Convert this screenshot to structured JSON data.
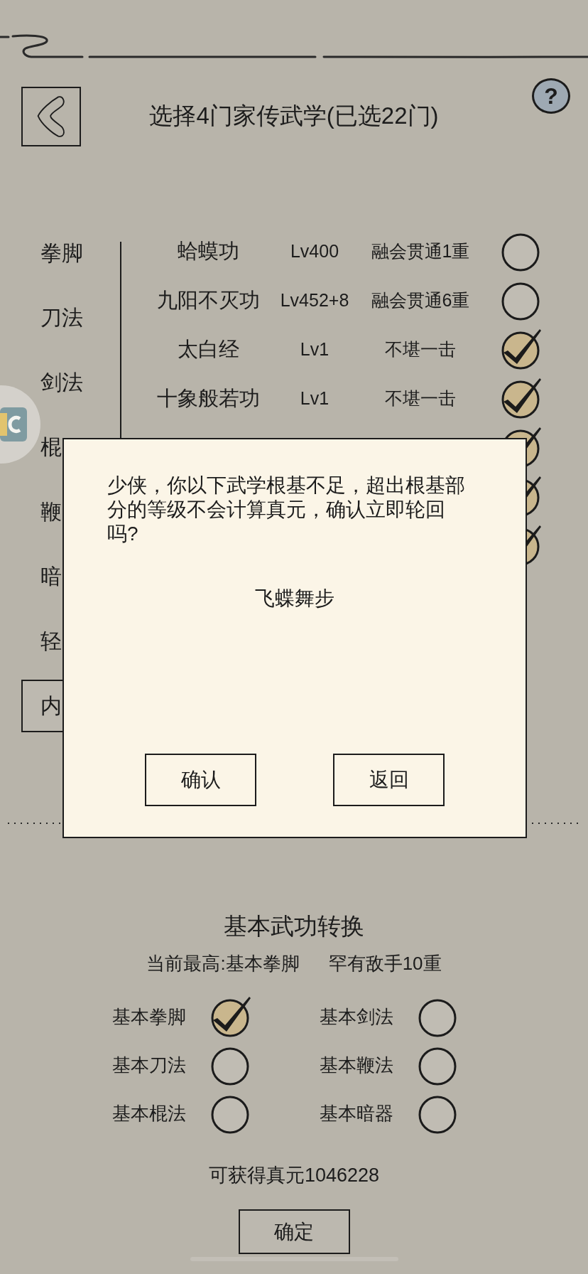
{
  "header": {
    "title": "选择4门家传武学(已选22门)",
    "help": "?"
  },
  "categories": [
    {
      "label": "拳脚",
      "selected": false
    },
    {
      "label": "刀法",
      "selected": false
    },
    {
      "label": "剑法",
      "selected": false
    },
    {
      "label": "棍",
      "selected": false
    },
    {
      "label": "鞭",
      "selected": false
    },
    {
      "label": "暗",
      "selected": false
    },
    {
      "label": "轻",
      "selected": false
    },
    {
      "label": "内",
      "selected": true
    }
  ],
  "skills": [
    {
      "name": "蛤蟆功",
      "level": "Lv400",
      "rank": "融会贯通1重",
      "checked": false
    },
    {
      "name": "九阳不灭功",
      "level": "Lv452+8",
      "rank": "融会贯通6重",
      "checked": false
    },
    {
      "name": "太白经",
      "level": "Lv1",
      "rank": "不堪一击",
      "checked": true
    },
    {
      "name": "十象般若功",
      "level": "Lv1",
      "rank": "不堪一击",
      "checked": true
    },
    {
      "checked": true
    },
    {
      "checked": true
    },
    {
      "checked": true
    }
  ],
  "conversion": {
    "title": "基本武功转换",
    "current": "当前最高:基本拳脚",
    "rank": "罕有敌手10重",
    "options": [
      {
        "label": "基本拳脚",
        "checked": true
      },
      {
        "label": "基本剑法",
        "checked": false
      },
      {
        "label": "基本刀法",
        "checked": false
      },
      {
        "label": "基本鞭法",
        "checked": false
      },
      {
        "label": "基本棍法",
        "checked": false
      },
      {
        "label": "基本暗器",
        "checked": false
      }
    ],
    "reward": "可获得真元1046228",
    "confirm": "确定"
  },
  "dialog": {
    "message": "少侠，你以下武学根基不足，超出根基部分的等级不会计算真元，确认立即轮回吗?",
    "skill": "飞蝶舞步",
    "buttons": [
      "确认",
      "返回"
    ]
  }
}
